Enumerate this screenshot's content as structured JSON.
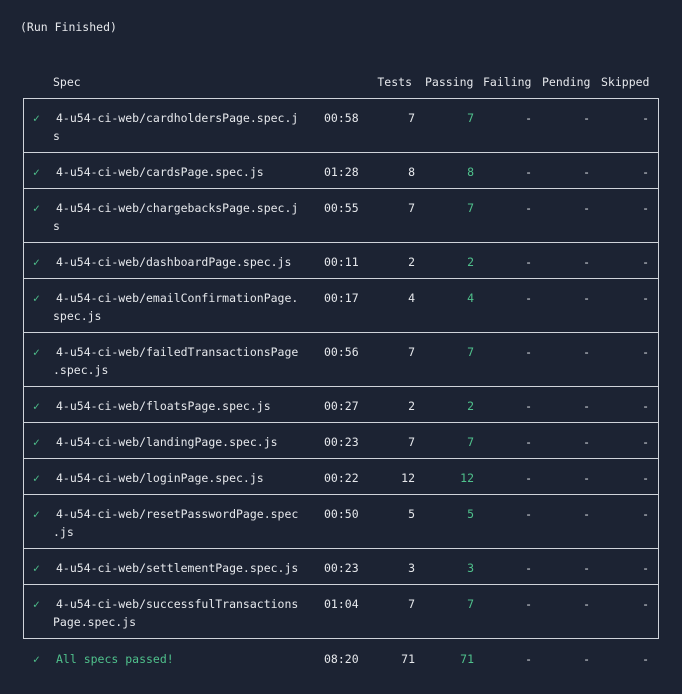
{
  "run_title": "(Run Finished)",
  "columns": {
    "spec": "Spec",
    "tests": "Tests",
    "passing": "Passing",
    "failing": "Failing",
    "pending": "Pending",
    "skipped": "Skipped"
  },
  "check_glyph": "✓",
  "rows": [
    {
      "spec_line1": "4-u54-ci-web/cardholdersPage.spec.j",
      "spec_line2": "s",
      "time": "00:58",
      "tests": "7",
      "passing": "7",
      "failing": "-",
      "pending": "-",
      "skipped": "-"
    },
    {
      "spec_line1": "4-u54-ci-web/cardsPage.spec.js",
      "spec_line2": "",
      "time": "01:28",
      "tests": "8",
      "passing": "8",
      "failing": "-",
      "pending": "-",
      "skipped": "-"
    },
    {
      "spec_line1": "4-u54-ci-web/chargebacksPage.spec.j",
      "spec_line2": "s",
      "time": "00:55",
      "tests": "7",
      "passing": "7",
      "failing": "-",
      "pending": "-",
      "skipped": "-"
    },
    {
      "spec_line1": "4-u54-ci-web/dashboardPage.spec.js",
      "spec_line2": "",
      "time": "00:11",
      "tests": "2",
      "passing": "2",
      "failing": "-",
      "pending": "-",
      "skipped": "-"
    },
    {
      "spec_line1": "4-u54-ci-web/emailConfirmationPage.",
      "spec_line2": "spec.js",
      "time": "00:17",
      "tests": "4",
      "passing": "4",
      "failing": "-",
      "pending": "-",
      "skipped": "-"
    },
    {
      "spec_line1": "4-u54-ci-web/failedTransactionsPage",
      "spec_line2": ".spec.js",
      "time": "00:56",
      "tests": "7",
      "passing": "7",
      "failing": "-",
      "pending": "-",
      "skipped": "-"
    },
    {
      "spec_line1": "4-u54-ci-web/floatsPage.spec.js",
      "spec_line2": "",
      "time": "00:27",
      "tests": "2",
      "passing": "2",
      "failing": "-",
      "pending": "-",
      "skipped": "-"
    },
    {
      "spec_line1": "4-u54-ci-web/landingPage.spec.js",
      "spec_line2": "",
      "time": "00:23",
      "tests": "7",
      "passing": "7",
      "failing": "-",
      "pending": "-",
      "skipped": "-"
    },
    {
      "spec_line1": "4-u54-ci-web/loginPage.spec.js",
      "spec_line2": "",
      "time": "00:22",
      "tests": "12",
      "passing": "12",
      "failing": "-",
      "pending": "-",
      "skipped": "-"
    },
    {
      "spec_line1": "4-u54-ci-web/resetPasswordPage.spec",
      "spec_line2": ".js",
      "time": "00:50",
      "tests": "5",
      "passing": "5",
      "failing": "-",
      "pending": "-",
      "skipped": "-"
    },
    {
      "spec_line1": "4-u54-ci-web/settlementPage.spec.js",
      "spec_line2": "",
      "time": "00:23",
      "tests": "3",
      "passing": "3",
      "failing": "-",
      "pending": "-",
      "skipped": "-"
    },
    {
      "spec_line1": "4-u54-ci-web/successfulTransactions",
      "spec_line2": "Page.spec.js",
      "time": "01:04",
      "tests": "7",
      "passing": "7",
      "failing": "-",
      "pending": "-",
      "skipped": "-"
    }
  ],
  "total": {
    "label": "All specs passed!",
    "time": "08:20",
    "tests": "71",
    "passing": "71",
    "failing": "-",
    "pending": "-",
    "skipped": "-"
  },
  "colors": {
    "background": "#1c2333",
    "text": "#e6e8ec",
    "success": "#4fc18c",
    "border": "#cfd3da"
  }
}
